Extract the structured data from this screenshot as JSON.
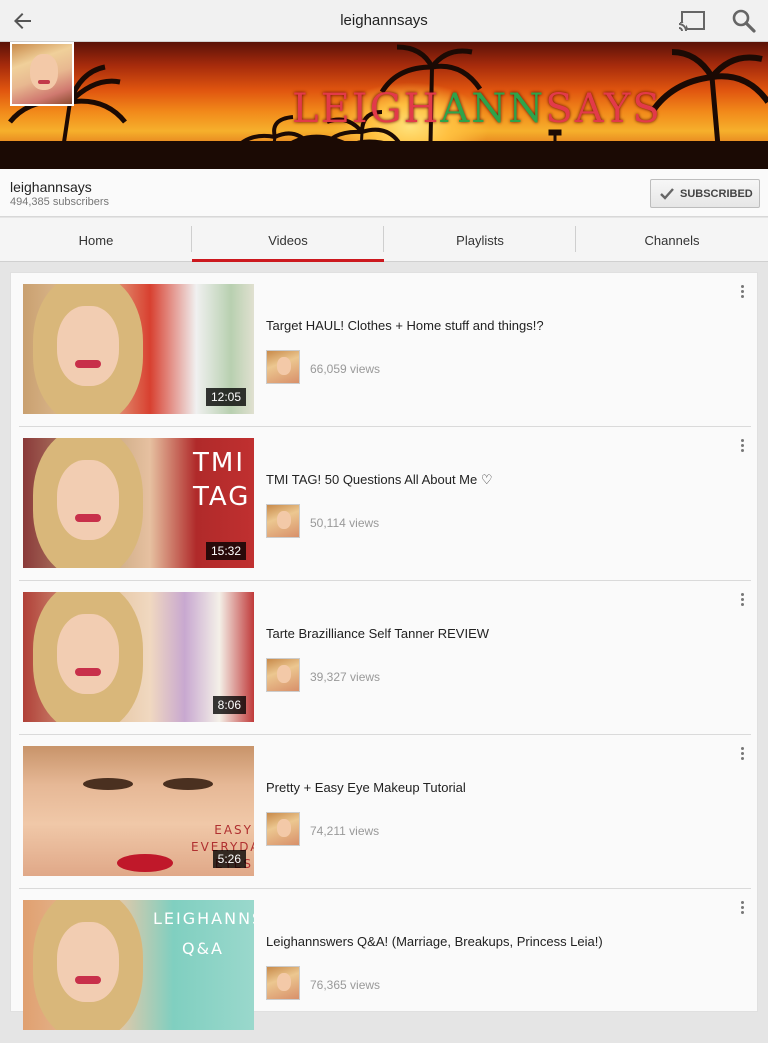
{
  "header": {
    "title": "leighannsays",
    "icons": {
      "back": "arrow-left-icon",
      "cast": "cast-icon",
      "search": "search-icon"
    }
  },
  "banner": {
    "logo_part1": "LEIGH",
    "logo_part2": "ANN",
    "logo_part3": "SAYS"
  },
  "channel": {
    "name": "leighannsays",
    "subscribers": "494,385 subscribers",
    "subscribe_label": "SUBSCRIBED"
  },
  "tabs": [
    {
      "label": "Home"
    },
    {
      "label": "Videos"
    },
    {
      "label": "Playlists"
    },
    {
      "label": "Channels"
    }
  ],
  "active_tab": "Videos",
  "colors": {
    "accent": "#cc181e"
  },
  "videos": [
    {
      "title": "Target HAUL! Clothes + Home stuff and things!?",
      "views": "66,059 views",
      "duration": "12:05"
    },
    {
      "title": "TMI TAG! 50 Questions All About Me ♡",
      "views": "50,114 views",
      "duration": "15:32",
      "thumb_text": "TMI TAG"
    },
    {
      "title": "Tarte Brazilliance Self Tanner REVIEW",
      "views": "39,327 views",
      "duration": "8:06"
    },
    {
      "title": "Pretty + Easy Eye Makeup Tutorial",
      "views": "74,211 views",
      "duration": "5:26",
      "thumb_text": "EASY EVERYDAY EYES"
    },
    {
      "title": "Leighannswers Q&A! (Marriage, Breakups, Princess Leia!)",
      "views": "76,365 views",
      "duration": "",
      "thumb_text": "LEIGHANNSWERS Q&A"
    }
  ]
}
